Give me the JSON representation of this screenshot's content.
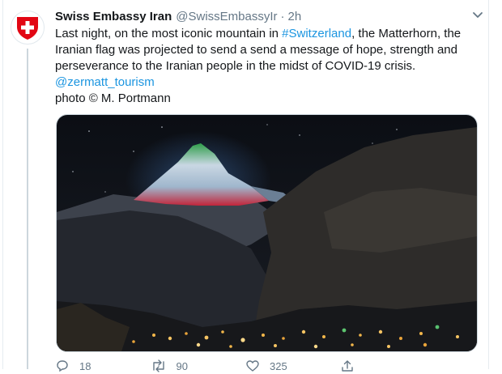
{
  "tweet": {
    "display_name": "Swiss Embassy Iran",
    "handle": "@SwissEmbassyIr",
    "separator": "·",
    "time": "2h",
    "text": {
      "l1_pre": "Last night, on the most iconic mountain in ",
      "l1_hashtag": "#Switzerland",
      "l1_post": ", the Matterhorn, the",
      "l2": "Iranian flag was projected to send a send a message of hope, strength and",
      "l3": "perseverance to the Iranian people in the midst of COVID-19 crisis.",
      "l4_mention": "@zermatt_tourism",
      "l5": "photo © M. Portmann"
    },
    "media_description_icon": "photo-matterhorn-iranian-flag",
    "actions": {
      "reply_count": "18",
      "retweet_count": "90",
      "like_count": "325"
    }
  },
  "colors": {
    "link": "#1b95e0",
    "secondary_text": "#657786",
    "swiss_red": "#e20613",
    "thread_line": "#ccd6dd"
  },
  "icons": {
    "avatar": "swiss-shield-icon",
    "caret": "chevron-down-icon",
    "reply": "reply-icon",
    "retweet": "retweet-icon",
    "like": "heart-icon",
    "share": "share-icon"
  }
}
